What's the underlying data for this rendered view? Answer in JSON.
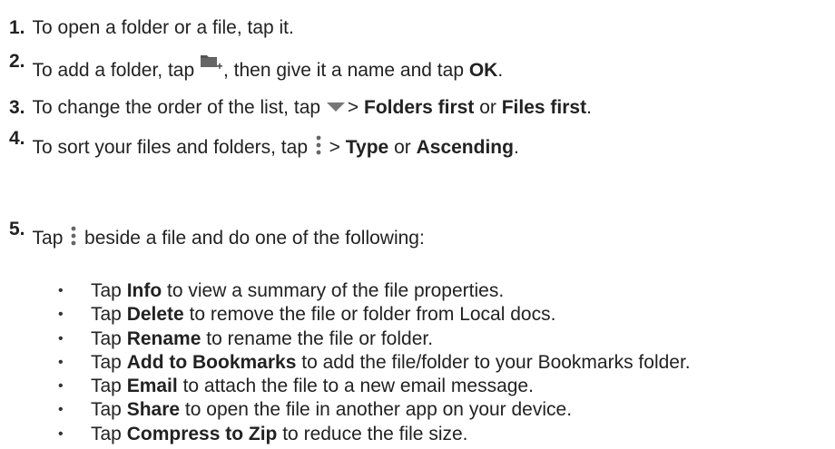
{
  "steps": [
    {
      "num": "1.",
      "parts": {
        "a": "To open a folder or a file, tap it."
      }
    },
    {
      "num": "2.",
      "parts": {
        "a": "To add a folder, tap ",
        "b": ", then give it a name and tap ",
        "c": "OK",
        "d": "."
      }
    },
    {
      "num": "3.",
      "parts": {
        "a": "To change the order of the list, tap ",
        "b": "> ",
        "c": "Folders first",
        "d": " or ",
        "e": "Files first",
        "f": "."
      }
    },
    {
      "num": "4.",
      "parts": {
        "a": "To sort your files and folders, tap ",
        "b": " > ",
        "c": "Type",
        "d": " or ",
        "e": "Ascending",
        "f": "."
      }
    },
    {
      "num": "5.",
      "parts": {
        "a": "Tap ",
        "b": " beside a file and do one of the following:"
      }
    }
  ],
  "bullets": [
    {
      "pre": "Tap ",
      "bold": "Info",
      "post": " to view a summary of the file properties."
    },
    {
      "pre": "Tap ",
      "bold": "Delete",
      "post": " to remove the file or folder from Local docs."
    },
    {
      "pre": "Tap ",
      "bold": "Rename",
      "post": " to rename the file or folder."
    },
    {
      "pre": "Tap ",
      "bold": "Add to Bookmarks",
      "post": " to add the file/folder to your Bookmarks folder."
    },
    {
      "pre": "Tap ",
      "bold": "Email",
      "post": " to attach the file to a new email message."
    },
    {
      "pre": "Tap ",
      "bold": "Share",
      "post": " to open the file in another app on your device."
    },
    {
      "pre": "Tap ",
      "bold": "Compress to Zip",
      "post": " to reduce the file size."
    }
  ],
  "bullet_glyph": "•",
  "icons": {
    "add_folder": "new-folder-icon",
    "sort_order": "dropdown-triangle-icon",
    "overflow_menu": "vertical-dots-menu-icon"
  },
  "colors": {
    "text": "#222222",
    "icon": "#666666"
  }
}
